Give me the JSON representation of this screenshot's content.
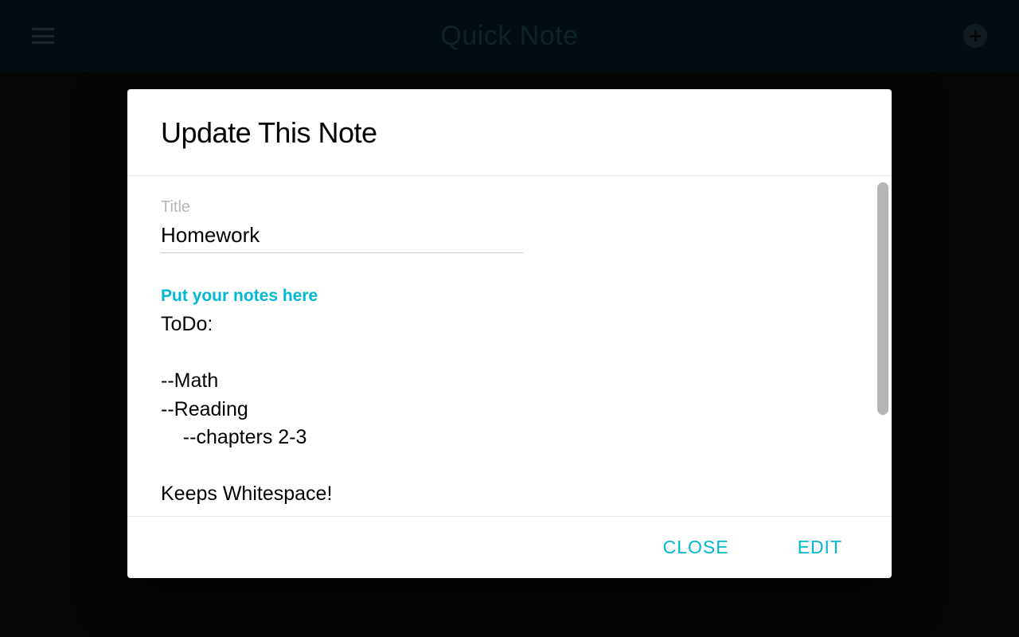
{
  "header": {
    "title": "Quick Note"
  },
  "dialog": {
    "title": "Update This Note",
    "fields": {
      "title_label": "Title",
      "title_value": "Homework",
      "notes_label": "Put your notes here",
      "notes_value": "ToDo:\n\n--Math\n--Reading\n    --chapters 2-3\n\nKeeps Whitespace!"
    },
    "buttons": {
      "close": "CLOSE",
      "edit": "EDIT"
    }
  }
}
